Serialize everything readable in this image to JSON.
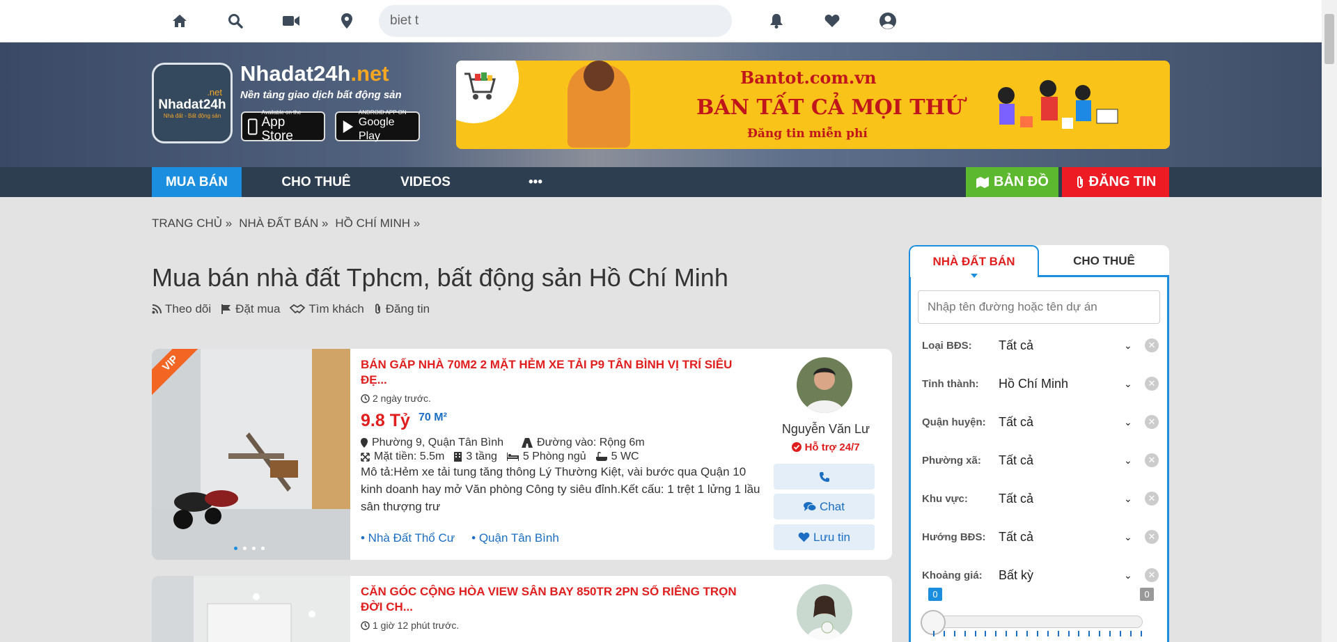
{
  "topbar": {
    "search_value": "biet t",
    "icons": [
      "home-icon",
      "search-icon",
      "video-icon",
      "map-marker-icon",
      "bell-icon",
      "heart-icon",
      "user-icon"
    ]
  },
  "header": {
    "logo_net": ".net",
    "logo_name": "Nhadat24h",
    "logo_tagline": "Nhà đất - Bất động sản",
    "brand_name": "Nhadat24h",
    "brand_suffix": ".net",
    "slogan": "Nền tảng giao dịch bất động sản",
    "appstore_small": "Available on the",
    "appstore_big": "App Store",
    "googleplay_small": "ANDROID APP ON",
    "googleplay_big": "Google Play",
    "banner_line1": "Bantot.com.vn",
    "banner_line2": "BÁN TẤT CẢ MỌI THỨ",
    "banner_line3": "Đăng tin miễn phí"
  },
  "nav": {
    "items": [
      "MUA BÁN",
      "CHO THUÊ",
      "VIDEOS",
      "•••"
    ],
    "map_label": "BẢN ĐỒ",
    "post_label": "ĐĂNG TIN"
  },
  "breadcrumb": [
    "TRANG CHỦ »",
    "NHÀ ĐẤT BÁN »",
    "HỒ CHÍ MINH »"
  ],
  "page_title": "Mua bán nhà đất Tphcm, bất động sản Hồ Chí Minh",
  "actions": [
    "Theo dõi",
    "Đặt mua",
    "Tìm khách",
    "Đăng tin"
  ],
  "listings": [
    {
      "vip": "VIP",
      "title": "BÁN GẤP NHÀ 70M2 2 MẶT HẺM XE TẢI P9 TÂN BÌNH VỊ TRÍ SIÊU ĐẸ...",
      "time": "2 ngày trước.",
      "price": "9.8 Tỷ",
      "area": "70 M²",
      "location": "Phường 9, Quận Tân Bình",
      "road": "Đường vào: Rộng 6m",
      "frontage": "Mặt tiền: 5.5m",
      "floors": "3 tầng",
      "bedrooms": "5 Phòng ngủ",
      "wc": "5 WC",
      "description": "Mô tả:Hẻm xe tải tung tăng thông Lý Thường Kiệt, vài bước qua Quận 10 kinh doanh hay mở Văn phòng Công ty siêu đỉnh.Kết cấu: 1 trệt 1 lửng 1 lầu sân thượng trư",
      "tag1": "• Nhà Đất Thổ Cư",
      "tag2": "• Quận Tân Bình",
      "agent": "Nguyễn Văn Lư",
      "support": "Hỗ trợ 24/7",
      "chat": "Chat",
      "save": "Lưu tin"
    },
    {
      "title": "CĂN GÓC CỘNG HÒA VIEW SÂN BAY 850TR 2PN SỔ RIÊNG TRỌN ĐỜI CH...",
      "time": "1 giờ 12 phút trước."
    }
  ],
  "sidebar": {
    "tab_active": "NHÀ ĐẤT BÁN",
    "tab_other": "CHO THUÊ",
    "search_placeholder": "Nhập tên đường hoặc tên dự án",
    "filters": [
      {
        "label": "Loại BĐS:",
        "value": "Tất cả"
      },
      {
        "label": "Tỉnh thành:",
        "value": "Hồ Chí Minh"
      },
      {
        "label": "Quận huyện:",
        "value": "Tất cả"
      },
      {
        "label": "Phường xã:",
        "value": "Tất cả"
      },
      {
        "label": "Khu vực:",
        "value": "Tất cả"
      },
      {
        "label": "Hướng BĐS:",
        "value": "Tất cả"
      },
      {
        "label": "Khoảng giá:",
        "value": "Bất kỳ"
      }
    ],
    "range_min": "0",
    "range_max": "0"
  },
  "colors": {
    "primary_blue": "#1b8ee0",
    "nav_dark": "#2c3e50",
    "red": "#e01e1e",
    "green": "#5cb82f",
    "banner_yellow": "#f9c31a"
  }
}
